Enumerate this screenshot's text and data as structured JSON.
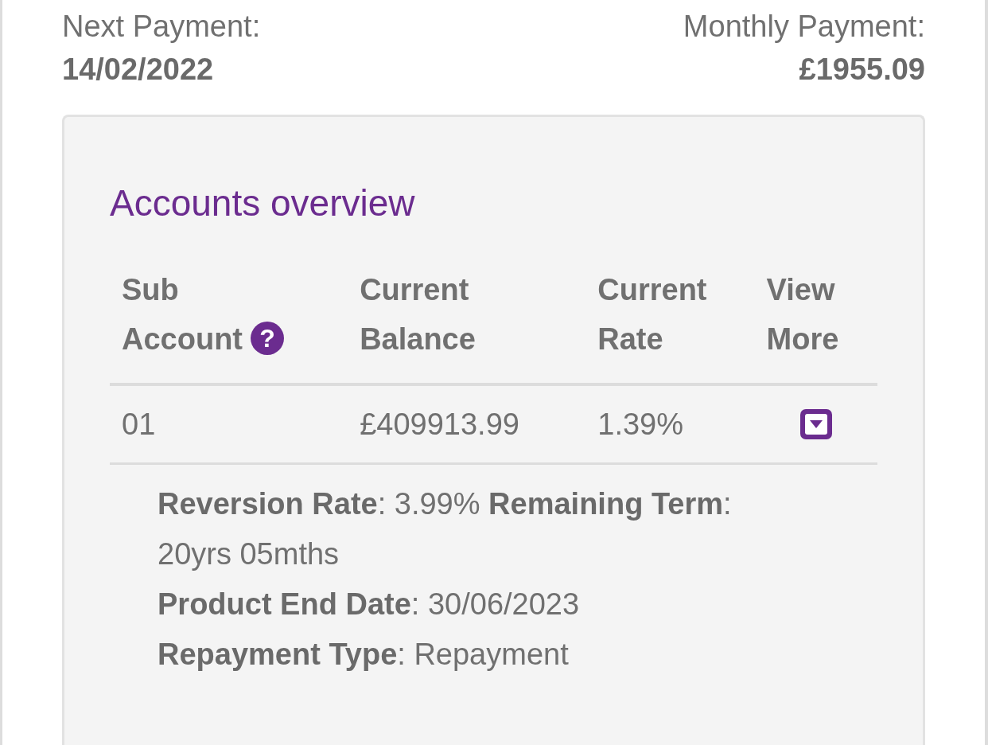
{
  "summary": [
    {
      "label": "Next Payment:",
      "value": "14/02/2022"
    },
    {
      "label": "Monthly Payment:",
      "value": "£1955.09"
    }
  ],
  "accounts": {
    "title": "Accounts overview",
    "columns": [
      {
        "lines": [
          "Sub",
          "Account"
        ],
        "help": "?"
      },
      {
        "lines": [
          "Current",
          "Balance"
        ]
      },
      {
        "lines": [
          "Current",
          "Rate"
        ]
      },
      {
        "lines": [
          "View",
          "More"
        ]
      }
    ],
    "rows": [
      {
        "cells": [
          "01",
          "£409913.99",
          "1.39%"
        ],
        "expanded": true,
        "details": [
          "**Reversion Rate**: 3.99% **Remaining Term**: 20yrs 05mths",
          "**Product End Date**: 30/06/2023",
          "**Repayment Type**: Repayment"
        ]
      }
    ]
  }
}
